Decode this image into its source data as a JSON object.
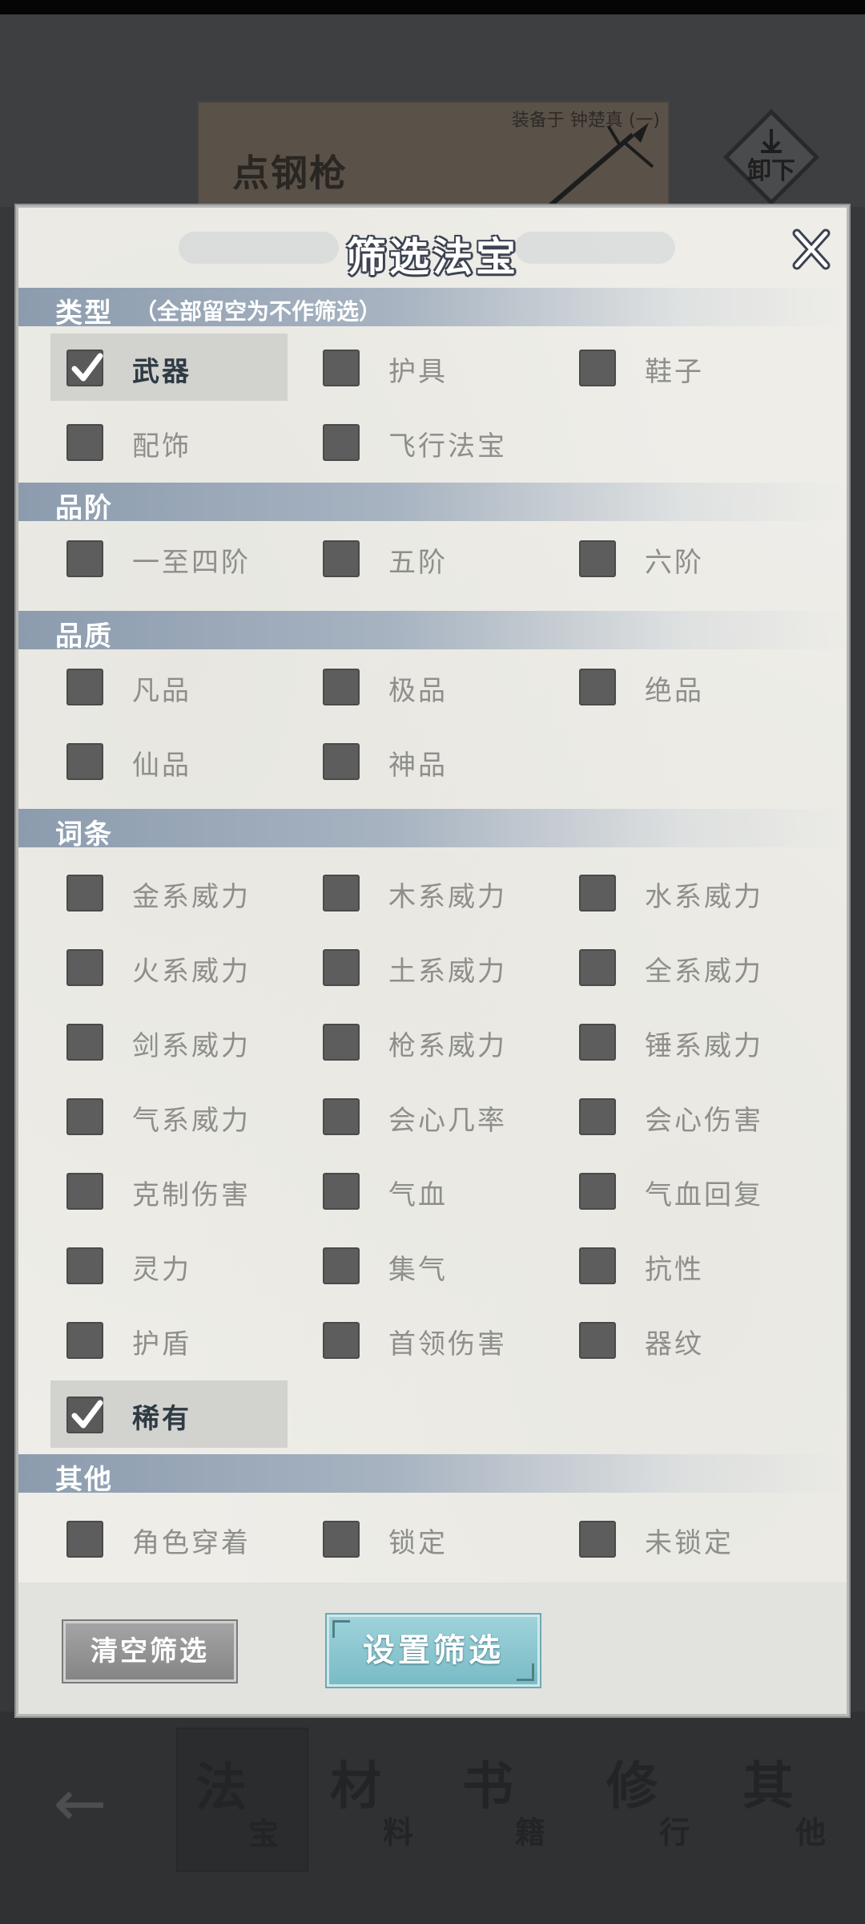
{
  "background": {
    "item_name": "点钢枪",
    "equipped_on": "装备于 钟楚真 (一)",
    "unequip_label": "卸下",
    "nav": {
      "tabs": [
        {
          "big": "法",
          "small": "宝"
        },
        {
          "big": "材",
          "small": "料"
        },
        {
          "big": "书",
          "small": "籍"
        },
        {
          "big": "修",
          "small": "行"
        },
        {
          "big": "其",
          "small": "他"
        }
      ]
    }
  },
  "dialog": {
    "title": "筛选法宝",
    "sections": {
      "type": {
        "title": "类型",
        "hint": "（全部留空为不作筛选）",
        "options": [
          {
            "label": "武器",
            "checked": true
          },
          {
            "label": "护具",
            "checked": false
          },
          {
            "label": "鞋子",
            "checked": false
          },
          {
            "label": "配饰",
            "checked": false
          },
          {
            "label": "飞行法宝",
            "checked": false
          }
        ]
      },
      "rank": {
        "title": "品阶",
        "options": [
          {
            "label": "一至四阶",
            "checked": false
          },
          {
            "label": "五阶",
            "checked": false
          },
          {
            "label": "六阶",
            "checked": false
          }
        ]
      },
      "quality": {
        "title": "品质",
        "options": [
          {
            "label": "凡品",
            "checked": false
          },
          {
            "label": "极品",
            "checked": false
          },
          {
            "label": "绝品",
            "checked": false
          },
          {
            "label": "仙品",
            "checked": false
          },
          {
            "label": "神品",
            "checked": false
          }
        ]
      },
      "affix": {
        "title": "词条",
        "options": [
          {
            "label": "金系威力",
            "checked": false
          },
          {
            "label": "木系威力",
            "checked": false
          },
          {
            "label": "水系威力",
            "checked": false
          },
          {
            "label": "火系威力",
            "checked": false
          },
          {
            "label": "土系威力",
            "checked": false
          },
          {
            "label": "全系威力",
            "checked": false
          },
          {
            "label": "剑系威力",
            "checked": false
          },
          {
            "label": "枪系威力",
            "checked": false
          },
          {
            "label": "锤系威力",
            "checked": false
          },
          {
            "label": "气系威力",
            "checked": false
          },
          {
            "label": "会心几率",
            "checked": false
          },
          {
            "label": "会心伤害",
            "checked": false
          },
          {
            "label": "克制伤害",
            "checked": false
          },
          {
            "label": "气血",
            "checked": false
          },
          {
            "label": "气血回复",
            "checked": false
          },
          {
            "label": "灵力",
            "checked": false
          },
          {
            "label": "集气",
            "checked": false
          },
          {
            "label": "抗性",
            "checked": false
          },
          {
            "label": "护盾",
            "checked": false
          },
          {
            "label": "首领伤害",
            "checked": false
          },
          {
            "label": "器纹",
            "checked": false
          },
          {
            "label": "稀有",
            "checked": true
          }
        ]
      },
      "other": {
        "title": "其他",
        "options": [
          {
            "label": "角色穿着",
            "checked": false
          },
          {
            "label": "锁定",
            "checked": false
          },
          {
            "label": "未锁定",
            "checked": false
          }
        ]
      }
    },
    "buttons": {
      "clear": "清空筛选",
      "apply": "设置筛选"
    }
  }
}
